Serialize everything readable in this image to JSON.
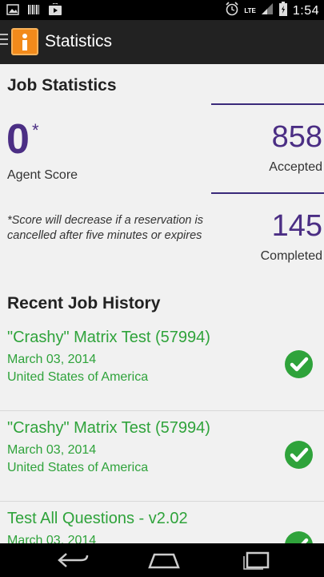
{
  "status_bar": {
    "time": "1:54",
    "network": "LTE",
    "icons": [
      "image-icon",
      "barcode-icon",
      "play-store-icon",
      "alarm-icon",
      "signal-icon",
      "battery-icon"
    ]
  },
  "header": {
    "title": "Statistics",
    "app_icon": "info-app-icon",
    "accent": "#f28a1b"
  },
  "job_stats": {
    "heading": "Job Statistics",
    "agent_score": "0",
    "score_marker": "*",
    "agent_score_label": "Agent Score",
    "note": "*Score will decrease if a reservation is cancelled after five minutes or expires",
    "accepted_value": "858",
    "accepted_label": "Accepted",
    "completed_value": "145",
    "completed_label": "Completed",
    "stat_color": "#4b2e84"
  },
  "history": {
    "heading": "Recent Job History",
    "item_color": "#2fa33b",
    "items": [
      {
        "title": "\"Crashy\" Matrix Test (57994)",
        "date": "March 03, 2014",
        "country": "United States of America",
        "status_icon": "check-circle-icon"
      },
      {
        "title": "\"Crashy\" Matrix Test (57994)",
        "date": "March 03, 2014",
        "country": "United States of America",
        "status_icon": "check-circle-icon"
      },
      {
        "title": "Test All Questions - v2.02",
        "date": "March 03, 2014",
        "country": "",
        "status_icon": "check-circle-icon"
      }
    ]
  },
  "nav_bar": {
    "buttons": [
      "back-icon",
      "home-icon",
      "recent-apps-icon"
    ]
  }
}
